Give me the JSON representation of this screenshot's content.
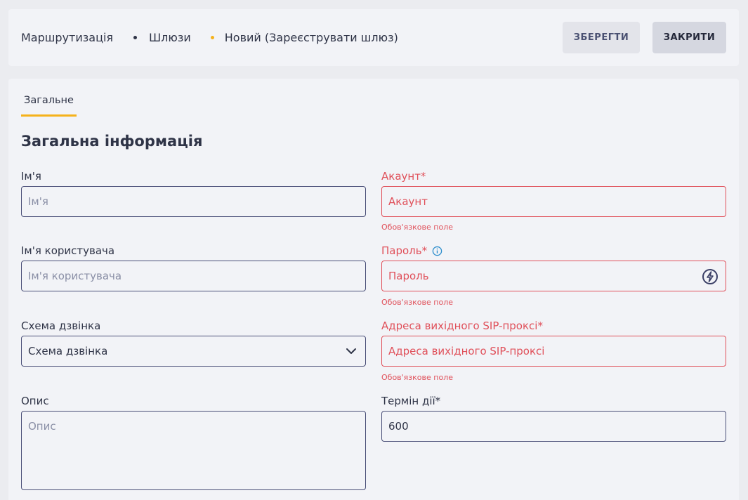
{
  "breadcrumb": {
    "items": [
      "Маршрутизація",
      "Шлюзи",
      "Новий (Зареєструвати шлюз)"
    ]
  },
  "toolbar": {
    "save_label": "ЗБЕРЕГТИ",
    "close_label": "ЗАКРИТИ"
  },
  "tabs": [
    {
      "label": "Загальне",
      "active": true
    }
  ],
  "section_title": "Загальна інформація",
  "form": {
    "name": {
      "label": "Ім'я",
      "placeholder": "Ім'я",
      "value": ""
    },
    "account": {
      "label": "Акаунт*",
      "placeholder": "Акаунт",
      "value": "",
      "error": "Обов'язкове поле"
    },
    "username": {
      "label": "Ім'я користувача",
      "placeholder": "Ім'я користувача",
      "value": ""
    },
    "password": {
      "label": "Пароль*",
      "placeholder": "Пароль",
      "value": "",
      "error": "Обов'язкове поле",
      "info_icon": "info-icon",
      "action_icon": "generate-password-icon"
    },
    "call_scheme": {
      "label": "Схема дзвінка",
      "selected": "Схема дзвінка",
      "icon": "chevron-down-icon"
    },
    "sip_proxy": {
      "label": "Адреса вихідного SIP-проксі*",
      "placeholder": "Адреса вихідного SIP-проксі",
      "value": "",
      "error": "Обов'язкове поле"
    },
    "description": {
      "label": "Опис",
      "placeholder": "Опис",
      "value": ""
    },
    "expires": {
      "label": "Термін дії*",
      "value": "600"
    }
  },
  "colors": {
    "accent": "#f5b21b",
    "error": "#e0505a",
    "border": "#4a4f78",
    "info": "#2a8ccc"
  }
}
